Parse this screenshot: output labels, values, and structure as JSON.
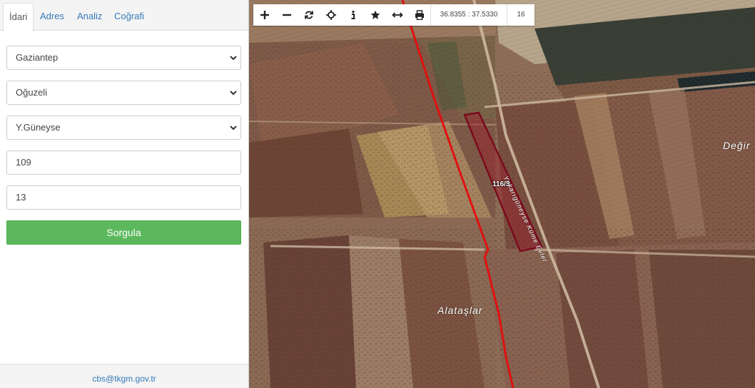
{
  "tabs": [
    "İdari",
    "Adres",
    "Analiz",
    "Coğrafi"
  ],
  "form": {
    "il": "Gaziantep",
    "ilce": "Oğuzeli",
    "mahalle": "Y.Güneyse",
    "ada": "109",
    "parsel": "13",
    "submit_label": "Sorgula"
  },
  "footer": {
    "email": "cbs@tkgm.gov.tr"
  },
  "toolbar": {
    "coordinates": "36.8355 : 37.5330",
    "zoom": "16"
  },
  "map": {
    "parcel_label": "116/3",
    "road_label": "Yukarıgüneyse Küme Evler",
    "place_label_1": "Alataşlar",
    "place_label_2": "Değir"
  },
  "colors": {
    "accent": "#337ab7",
    "submit": "#5cb85c",
    "boundary": "#e01010",
    "parcel": "#9b1c2a"
  }
}
